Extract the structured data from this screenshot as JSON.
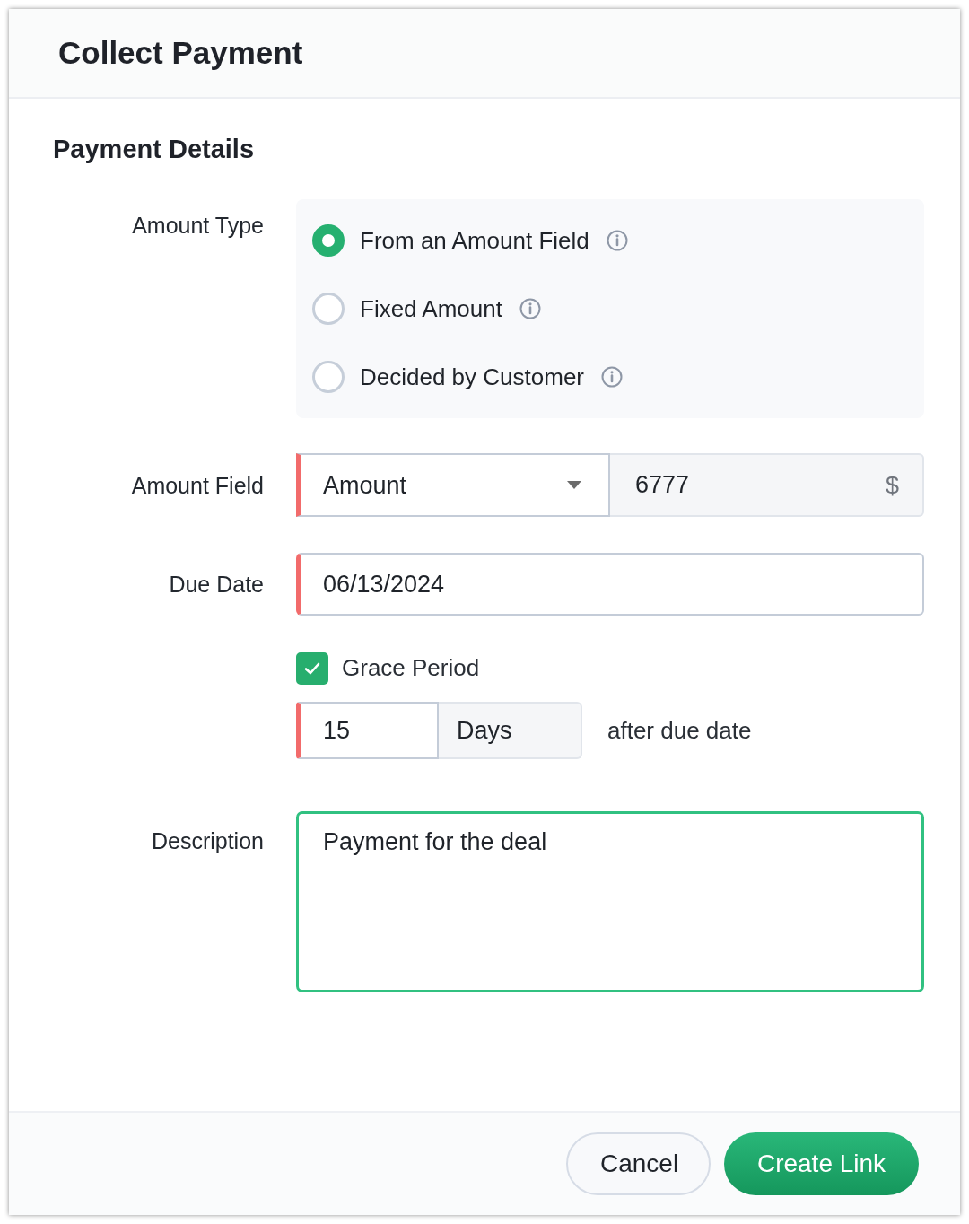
{
  "dialog": {
    "title": "Collect Payment"
  },
  "section": {
    "title": "Payment Details"
  },
  "amount_type": {
    "label": "Amount Type",
    "options": [
      {
        "label": "From an Amount Field",
        "selected": true
      },
      {
        "label": "Fixed Amount",
        "selected": false
      },
      {
        "label": "Decided by Customer",
        "selected": false
      }
    ]
  },
  "amount_field": {
    "label": "Amount Field",
    "required": true,
    "field": "Amount",
    "value": "6777",
    "currency": "$"
  },
  "due_date": {
    "label": "Due Date",
    "required": true,
    "value": "06/13/2024"
  },
  "grace_period": {
    "label": "Grace Period",
    "checked": true,
    "required": true,
    "days": "15",
    "unit": "Days",
    "suffix": "after due date"
  },
  "description": {
    "label": "Description",
    "value": "Payment for the deal",
    "focused": true
  },
  "buttons": [
    {
      "label": "Cancel",
      "kind": "secondary"
    },
    {
      "label": "Create Link",
      "kind": "primary"
    }
  ]
}
